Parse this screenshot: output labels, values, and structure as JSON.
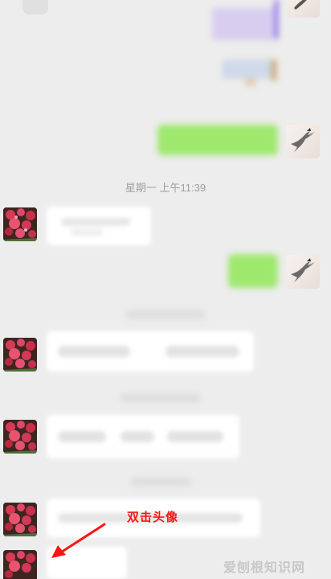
{
  "chat": {
    "timestamp": "星期一 上午11:39"
  },
  "annotation": {
    "text": "双击头像"
  },
  "watermark": {
    "text": "爱刨根知识网"
  },
  "colors": {
    "background": "#ededed",
    "self_bubble": "#9fe86e",
    "other_bubble": "#ffffff",
    "annotation": "#ff1414"
  },
  "icons": {
    "self_avatar": "bird-avatar-icon",
    "contact_avatar": "flower-avatar-icon",
    "arrow": "arrow-icon"
  }
}
